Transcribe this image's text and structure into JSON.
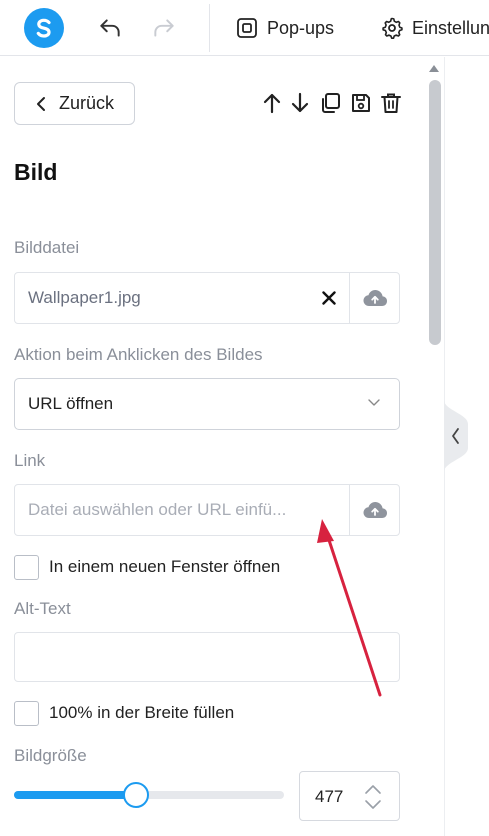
{
  "topbar": {
    "logo_letter": "S",
    "popups_label": "Pop-ups",
    "settings_label": "Einstellungen"
  },
  "panel": {
    "back_label": "Zurück",
    "section_title": "Bild",
    "image_file": {
      "label": "Bilddatei",
      "value": "Wallpaper1.jpg"
    },
    "click_action": {
      "label": "Aktion beim Anklicken des Bildes",
      "selected": "URL öffnen"
    },
    "link": {
      "label": "Link",
      "placeholder": "Datei auswählen oder URL einfü..."
    },
    "new_window_label": "In einem neuen Fenster öffnen",
    "alt_text": {
      "label": "Alt-Text",
      "value": ""
    },
    "full_width_label": "100% in der Breite füllen",
    "image_size": {
      "label": "Bildgröße",
      "value": "477",
      "slider_fraction": 0.45
    }
  },
  "colors": {
    "accent": "#1c9bf0",
    "annotation": "#d7223f"
  },
  "icons": [
    "undo-icon",
    "redo-icon",
    "popup-icon",
    "gear-icon",
    "chevron-left-icon",
    "arrow-up-icon",
    "arrow-down-icon",
    "copy-icon",
    "save-icon",
    "trash-icon",
    "close-icon",
    "cloud-upload-icon",
    "chevron-down-icon",
    "spinner-icon"
  ]
}
